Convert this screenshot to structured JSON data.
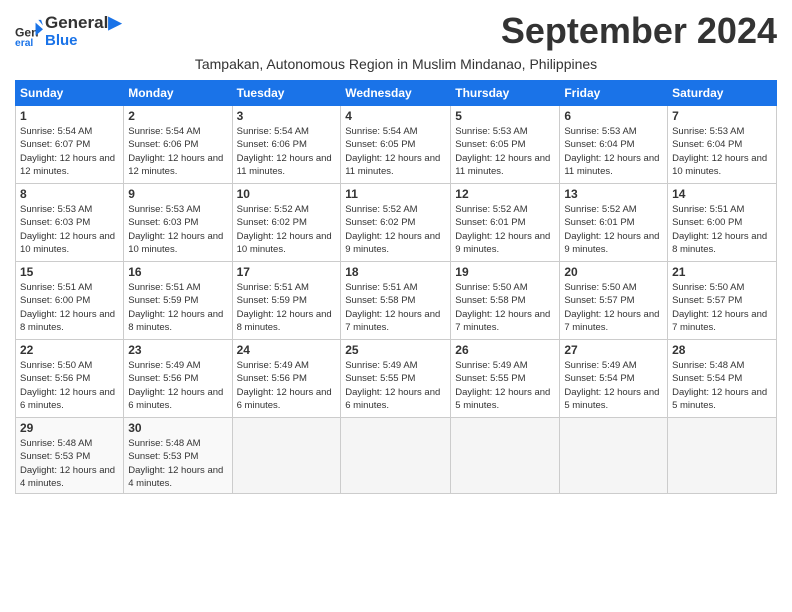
{
  "header": {
    "logo_line1": "General",
    "logo_line2": "Blue",
    "month_title": "September 2024",
    "subtitle": "Tampakan, Autonomous Region in Muslim Mindanao, Philippines"
  },
  "weekdays": [
    "Sunday",
    "Monday",
    "Tuesday",
    "Wednesday",
    "Thursday",
    "Friday",
    "Saturday"
  ],
  "weeks": [
    [
      {
        "day": "1",
        "sunrise": "5:54 AM",
        "sunset": "6:07 PM",
        "daylight": "12 hours and 12 minutes."
      },
      {
        "day": "2",
        "sunrise": "5:54 AM",
        "sunset": "6:06 PM",
        "daylight": "12 hours and 12 minutes."
      },
      {
        "day": "3",
        "sunrise": "5:54 AM",
        "sunset": "6:06 PM",
        "daylight": "12 hours and 11 minutes."
      },
      {
        "day": "4",
        "sunrise": "5:54 AM",
        "sunset": "6:05 PM",
        "daylight": "12 hours and 11 minutes."
      },
      {
        "day": "5",
        "sunrise": "5:53 AM",
        "sunset": "6:05 PM",
        "daylight": "12 hours and 11 minutes."
      },
      {
        "day": "6",
        "sunrise": "5:53 AM",
        "sunset": "6:04 PM",
        "daylight": "12 hours and 11 minutes."
      },
      {
        "day": "7",
        "sunrise": "5:53 AM",
        "sunset": "6:04 PM",
        "daylight": "12 hours and 10 minutes."
      }
    ],
    [
      {
        "day": "8",
        "sunrise": "5:53 AM",
        "sunset": "6:03 PM",
        "daylight": "12 hours and 10 minutes."
      },
      {
        "day": "9",
        "sunrise": "5:53 AM",
        "sunset": "6:03 PM",
        "daylight": "12 hours and 10 minutes."
      },
      {
        "day": "10",
        "sunrise": "5:52 AM",
        "sunset": "6:02 PM",
        "daylight": "12 hours and 10 minutes."
      },
      {
        "day": "11",
        "sunrise": "5:52 AM",
        "sunset": "6:02 PM",
        "daylight": "12 hours and 9 minutes."
      },
      {
        "day": "12",
        "sunrise": "5:52 AM",
        "sunset": "6:01 PM",
        "daylight": "12 hours and 9 minutes."
      },
      {
        "day": "13",
        "sunrise": "5:52 AM",
        "sunset": "6:01 PM",
        "daylight": "12 hours and 9 minutes."
      },
      {
        "day": "14",
        "sunrise": "5:51 AM",
        "sunset": "6:00 PM",
        "daylight": "12 hours and 8 minutes."
      }
    ],
    [
      {
        "day": "15",
        "sunrise": "5:51 AM",
        "sunset": "6:00 PM",
        "daylight": "12 hours and 8 minutes."
      },
      {
        "day": "16",
        "sunrise": "5:51 AM",
        "sunset": "5:59 PM",
        "daylight": "12 hours and 8 minutes."
      },
      {
        "day": "17",
        "sunrise": "5:51 AM",
        "sunset": "5:59 PM",
        "daylight": "12 hours and 8 minutes."
      },
      {
        "day": "18",
        "sunrise": "5:51 AM",
        "sunset": "5:58 PM",
        "daylight": "12 hours and 7 minutes."
      },
      {
        "day": "19",
        "sunrise": "5:50 AM",
        "sunset": "5:58 PM",
        "daylight": "12 hours and 7 minutes."
      },
      {
        "day": "20",
        "sunrise": "5:50 AM",
        "sunset": "5:57 PM",
        "daylight": "12 hours and 7 minutes."
      },
      {
        "day": "21",
        "sunrise": "5:50 AM",
        "sunset": "5:57 PM",
        "daylight": "12 hours and 7 minutes."
      }
    ],
    [
      {
        "day": "22",
        "sunrise": "5:50 AM",
        "sunset": "5:56 PM",
        "daylight": "12 hours and 6 minutes."
      },
      {
        "day": "23",
        "sunrise": "5:49 AM",
        "sunset": "5:56 PM",
        "daylight": "12 hours and 6 minutes."
      },
      {
        "day": "24",
        "sunrise": "5:49 AM",
        "sunset": "5:56 PM",
        "daylight": "12 hours and 6 minutes."
      },
      {
        "day": "25",
        "sunrise": "5:49 AM",
        "sunset": "5:55 PM",
        "daylight": "12 hours and 6 minutes."
      },
      {
        "day": "26",
        "sunrise": "5:49 AM",
        "sunset": "5:55 PM",
        "daylight": "12 hours and 5 minutes."
      },
      {
        "day": "27",
        "sunrise": "5:49 AM",
        "sunset": "5:54 PM",
        "daylight": "12 hours and 5 minutes."
      },
      {
        "day": "28",
        "sunrise": "5:48 AM",
        "sunset": "5:54 PM",
        "daylight": "12 hours and 5 minutes."
      }
    ],
    [
      {
        "day": "29",
        "sunrise": "5:48 AM",
        "sunset": "5:53 PM",
        "daylight": "12 hours and 4 minutes."
      },
      {
        "day": "30",
        "sunrise": "5:48 AM",
        "sunset": "5:53 PM",
        "daylight": "12 hours and 4 minutes."
      },
      null,
      null,
      null,
      null,
      null
    ]
  ]
}
